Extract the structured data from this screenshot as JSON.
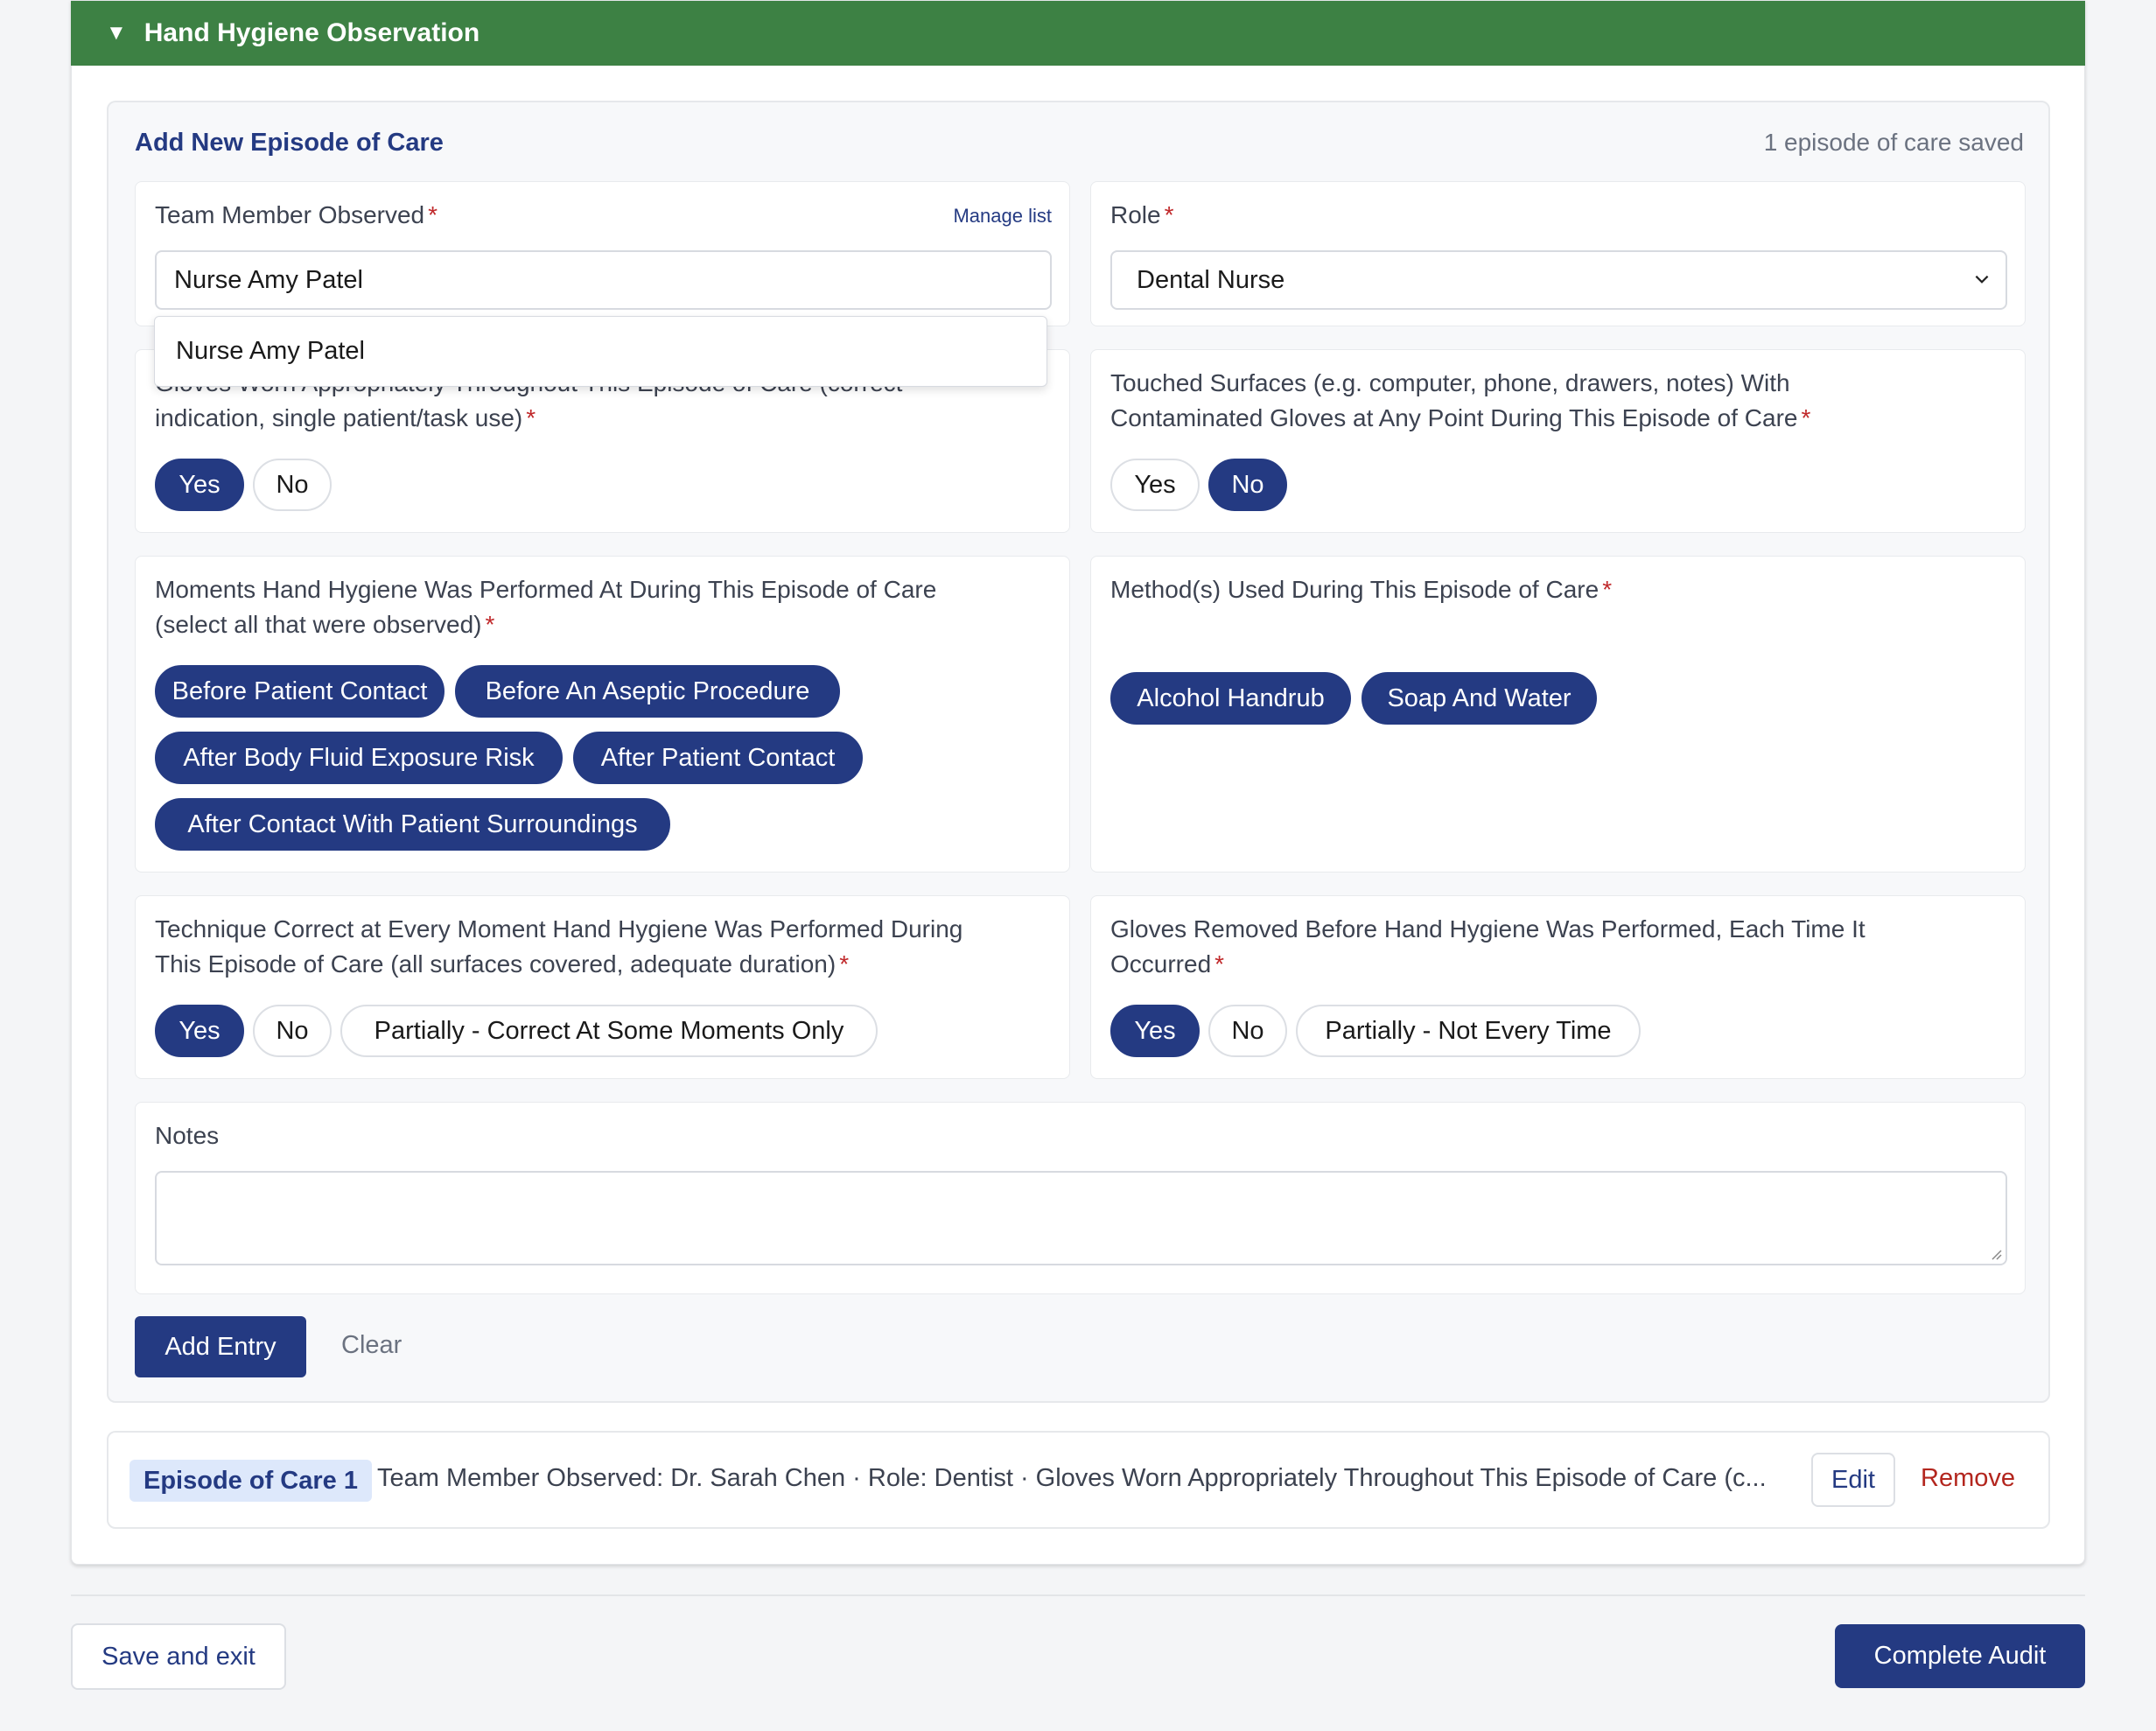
{
  "section": {
    "title": "Hand Hygiene Observation",
    "toggle_icon": "▼"
  },
  "form": {
    "title": "Add New Episode of Care",
    "saved_count_text": "1 episode of care saved",
    "team_member": {
      "label": "Team Member Observed",
      "manage_link": "Manage list",
      "value": "Nurse Amy Patel",
      "suggestion": "Nurse Amy Patel"
    },
    "role": {
      "label": "Role",
      "value": "Dental Nurse"
    },
    "gloves_worn": {
      "label_line1": "Gloves Worn Appropriately Throughout This Episode of Care (correct",
      "label_line2": "indication, single patient/task use)",
      "options": [
        "Yes",
        "No"
      ],
      "selected": "Yes"
    },
    "touched_surfaces": {
      "label_line1": "Touched Surfaces (e.g. computer, phone, drawers, notes) With",
      "label_line2": "Contaminated Gloves at Any Point During This Episode of Care",
      "options": [
        "Yes",
        "No"
      ],
      "selected": "No"
    },
    "moments": {
      "label_line1": "Moments Hand Hygiene Was Performed At During This Episode of Care",
      "label_line2": "(select all that were observed)",
      "options": [
        "Before Patient Contact",
        "Before An Aseptic Procedure",
        "After Body Fluid Exposure Risk",
        "After Patient Contact",
        "After Contact With Patient Surroundings"
      ]
    },
    "methods": {
      "label": "Method(s) Used During This Episode of Care",
      "options": [
        "Alcohol Handrub",
        "Soap And Water"
      ]
    },
    "technique": {
      "label_line1": "Technique Correct at Every Moment Hand Hygiene Was Performed During",
      "label_line2": "This Episode of Care (all surfaces covered, adequate duration)",
      "options": [
        "Yes",
        "No",
        "Partially - Correct At Some Moments Only"
      ],
      "selected": "Yes"
    },
    "gloves_removed": {
      "label_line1": "Gloves Removed Before Hand Hygiene Was Performed, Each Time It",
      "label_line2": "Occurred",
      "options": [
        "Yes",
        "No",
        "Partially - Not Every Time"
      ],
      "selected": "Yes"
    },
    "notes": {
      "label": "Notes",
      "value": ""
    },
    "add_entry_label": "Add Entry",
    "clear_label": "Clear",
    "required_marker": "*"
  },
  "saved_entries": [
    {
      "badge": "Episode of Care 1",
      "summary": "Team Member Observed: Dr. Sarah Chen · Role: Dentist · Gloves Worn Appropriately Throughout This Episode of Care (c...",
      "edit_label": "Edit",
      "remove_label": "Remove"
    }
  ],
  "footer": {
    "save_exit_label": "Save and exit",
    "complete_label": "Complete Audit"
  },
  "colors": {
    "header_green": "#3d8144",
    "primary_navy": "#243a82",
    "required_red": "#c0292b",
    "remove_red": "#b3261e",
    "badge_bg": "#dde8fb"
  }
}
